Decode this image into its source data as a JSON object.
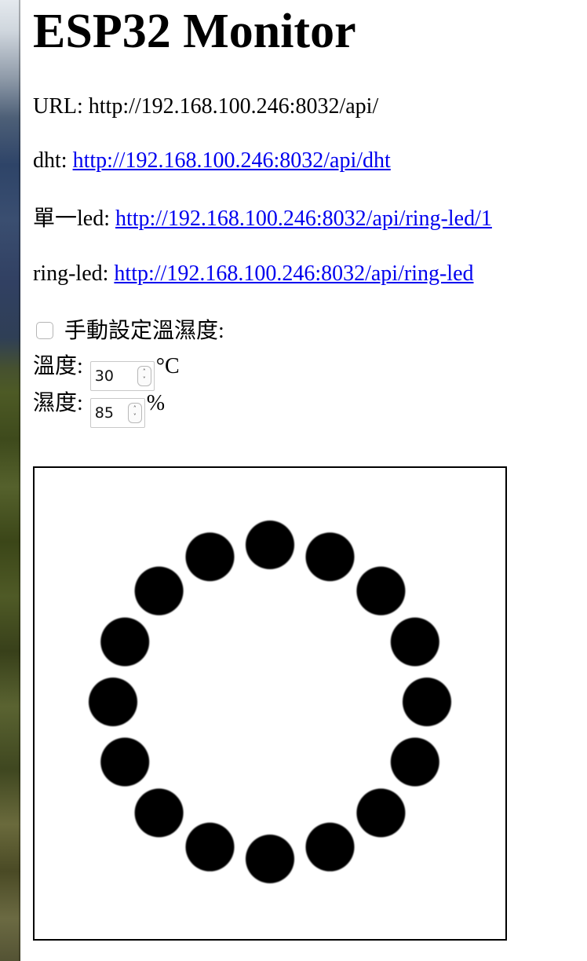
{
  "page": {
    "title": "ESP32 Monitor",
    "url_label": "URL:",
    "url_value": "http://192.168.100.246:8032/api/",
    "links": [
      {
        "label": "dht:",
        "href_text": "http://192.168.100.246:8032/api/dht"
      },
      {
        "label": "單一led:",
        "href_text": "http://192.168.100.246:8032/api/ring-led/1"
      },
      {
        "label": "ring-led:",
        "href_text": "http://192.168.100.246:8032/api/ring-led"
      }
    ]
  },
  "controls": {
    "manual_checkbox_label": "手動設定溫濕度:",
    "manual_checked": false,
    "temperature_label": "溫度:",
    "temperature_value": "30",
    "temperature_unit": "°C",
    "humidity_label": "濕度:",
    "humidity_value": "85",
    "humidity_unit": "%"
  },
  "ring": {
    "led_count": 16,
    "led_color": "#000000",
    "background_color": "#ffffff",
    "border_color": "#000000"
  },
  "icons": {
    "spinner_up": "chevron-up-icon",
    "spinner_down": "chevron-down-icon"
  }
}
